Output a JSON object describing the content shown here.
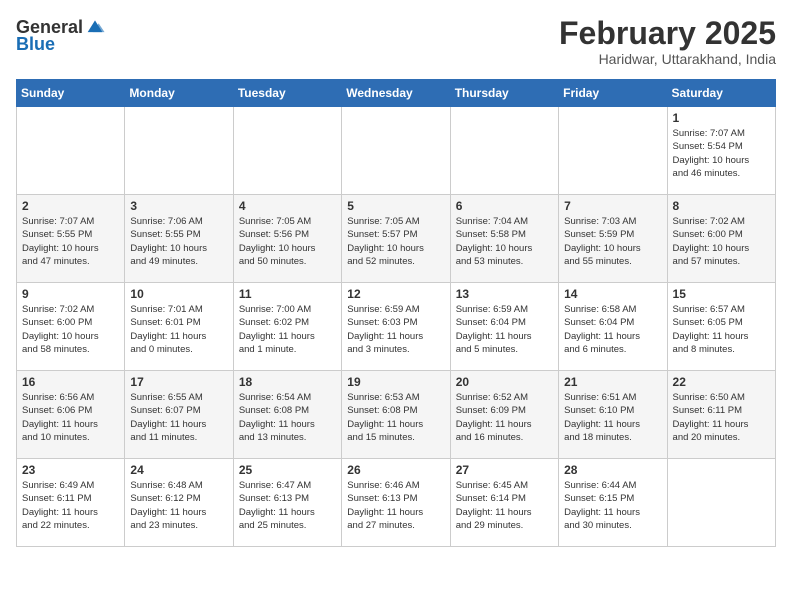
{
  "header": {
    "logo_general": "General",
    "logo_blue": "Blue",
    "month": "February 2025",
    "location": "Haridwar, Uttarakhand, India"
  },
  "weekdays": [
    "Sunday",
    "Monday",
    "Tuesday",
    "Wednesday",
    "Thursday",
    "Friday",
    "Saturday"
  ],
  "weeks": [
    [
      {
        "day": "",
        "info": ""
      },
      {
        "day": "",
        "info": ""
      },
      {
        "day": "",
        "info": ""
      },
      {
        "day": "",
        "info": ""
      },
      {
        "day": "",
        "info": ""
      },
      {
        "day": "",
        "info": ""
      },
      {
        "day": "1",
        "info": "Sunrise: 7:07 AM\nSunset: 5:54 PM\nDaylight: 10 hours\nand 46 minutes."
      }
    ],
    [
      {
        "day": "2",
        "info": "Sunrise: 7:07 AM\nSunset: 5:55 PM\nDaylight: 10 hours\nand 47 minutes."
      },
      {
        "day": "3",
        "info": "Sunrise: 7:06 AM\nSunset: 5:55 PM\nDaylight: 10 hours\nand 49 minutes."
      },
      {
        "day": "4",
        "info": "Sunrise: 7:05 AM\nSunset: 5:56 PM\nDaylight: 10 hours\nand 50 minutes."
      },
      {
        "day": "5",
        "info": "Sunrise: 7:05 AM\nSunset: 5:57 PM\nDaylight: 10 hours\nand 52 minutes."
      },
      {
        "day": "6",
        "info": "Sunrise: 7:04 AM\nSunset: 5:58 PM\nDaylight: 10 hours\nand 53 minutes."
      },
      {
        "day": "7",
        "info": "Sunrise: 7:03 AM\nSunset: 5:59 PM\nDaylight: 10 hours\nand 55 minutes."
      },
      {
        "day": "8",
        "info": "Sunrise: 7:02 AM\nSunset: 6:00 PM\nDaylight: 10 hours\nand 57 minutes."
      }
    ],
    [
      {
        "day": "9",
        "info": "Sunrise: 7:02 AM\nSunset: 6:00 PM\nDaylight: 10 hours\nand 58 minutes."
      },
      {
        "day": "10",
        "info": "Sunrise: 7:01 AM\nSunset: 6:01 PM\nDaylight: 11 hours\nand 0 minutes."
      },
      {
        "day": "11",
        "info": "Sunrise: 7:00 AM\nSunset: 6:02 PM\nDaylight: 11 hours\nand 1 minute."
      },
      {
        "day": "12",
        "info": "Sunrise: 6:59 AM\nSunset: 6:03 PM\nDaylight: 11 hours\nand 3 minutes."
      },
      {
        "day": "13",
        "info": "Sunrise: 6:59 AM\nSunset: 6:04 PM\nDaylight: 11 hours\nand 5 minutes."
      },
      {
        "day": "14",
        "info": "Sunrise: 6:58 AM\nSunset: 6:04 PM\nDaylight: 11 hours\nand 6 minutes."
      },
      {
        "day": "15",
        "info": "Sunrise: 6:57 AM\nSunset: 6:05 PM\nDaylight: 11 hours\nand 8 minutes."
      }
    ],
    [
      {
        "day": "16",
        "info": "Sunrise: 6:56 AM\nSunset: 6:06 PM\nDaylight: 11 hours\nand 10 minutes."
      },
      {
        "day": "17",
        "info": "Sunrise: 6:55 AM\nSunset: 6:07 PM\nDaylight: 11 hours\nand 11 minutes."
      },
      {
        "day": "18",
        "info": "Sunrise: 6:54 AM\nSunset: 6:08 PM\nDaylight: 11 hours\nand 13 minutes."
      },
      {
        "day": "19",
        "info": "Sunrise: 6:53 AM\nSunset: 6:08 PM\nDaylight: 11 hours\nand 15 minutes."
      },
      {
        "day": "20",
        "info": "Sunrise: 6:52 AM\nSunset: 6:09 PM\nDaylight: 11 hours\nand 16 minutes."
      },
      {
        "day": "21",
        "info": "Sunrise: 6:51 AM\nSunset: 6:10 PM\nDaylight: 11 hours\nand 18 minutes."
      },
      {
        "day": "22",
        "info": "Sunrise: 6:50 AM\nSunset: 6:11 PM\nDaylight: 11 hours\nand 20 minutes."
      }
    ],
    [
      {
        "day": "23",
        "info": "Sunrise: 6:49 AM\nSunset: 6:11 PM\nDaylight: 11 hours\nand 22 minutes."
      },
      {
        "day": "24",
        "info": "Sunrise: 6:48 AM\nSunset: 6:12 PM\nDaylight: 11 hours\nand 23 minutes."
      },
      {
        "day": "25",
        "info": "Sunrise: 6:47 AM\nSunset: 6:13 PM\nDaylight: 11 hours\nand 25 minutes."
      },
      {
        "day": "26",
        "info": "Sunrise: 6:46 AM\nSunset: 6:13 PM\nDaylight: 11 hours\nand 27 minutes."
      },
      {
        "day": "27",
        "info": "Sunrise: 6:45 AM\nSunset: 6:14 PM\nDaylight: 11 hours\nand 29 minutes."
      },
      {
        "day": "28",
        "info": "Sunrise: 6:44 AM\nSunset: 6:15 PM\nDaylight: 11 hours\nand 30 minutes."
      },
      {
        "day": "",
        "info": ""
      }
    ]
  ]
}
